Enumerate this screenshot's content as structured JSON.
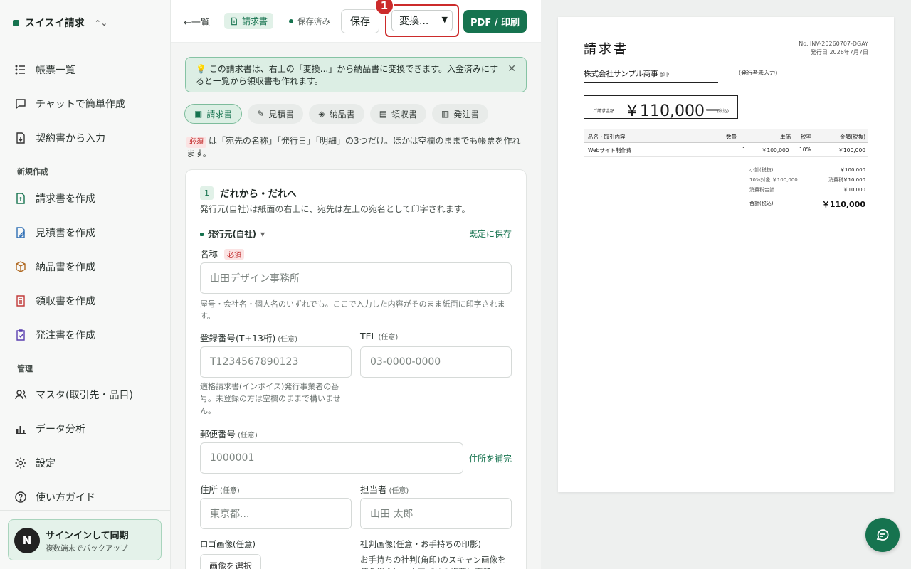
{
  "sidebar": {
    "brand": "スイスイ請求",
    "items": [
      {
        "label": "帳票一覧",
        "icon": "list-icon"
      },
      {
        "label": "チャットで簡単作成",
        "icon": "chat-icon"
      },
      {
        "label": "契約書から入力",
        "icon": "file-import-icon"
      }
    ],
    "section_new": "新規作成",
    "new_items": [
      {
        "label": "請求書を作成",
        "icon": "invoice-icon"
      },
      {
        "label": "見積書を作成",
        "icon": "quote-icon"
      },
      {
        "label": "納品書を作成",
        "icon": "box-icon"
      },
      {
        "label": "領収書を作成",
        "icon": "receipt-icon"
      },
      {
        "label": "発注書を作成",
        "icon": "order-icon"
      }
    ],
    "section_manage": "管理",
    "manage_items": [
      {
        "label": "マスタ(取引先・品目)",
        "icon": "users-icon"
      },
      {
        "label": "データ分析",
        "icon": "chart-icon"
      },
      {
        "label": "設定",
        "icon": "gear-icon"
      },
      {
        "label": "使い方ガイド",
        "icon": "help-icon"
      }
    ],
    "signin": {
      "avatar": "N",
      "title": "サインインして同期",
      "subtitle": "複数端末でバックアップ"
    }
  },
  "toolbar": {
    "back": "←一覧",
    "doc_type": "請求書",
    "status": "保存済み",
    "save": "保存",
    "convert": "変換...",
    "marker": "1",
    "pdf": "PDF / 印刷"
  },
  "editor": {
    "notice": "この請求書は、右上の「変換...」から納品書に変換できます。入金済みにすると一覧から領収書も作れます。",
    "tabs": [
      "請求書",
      "見積書",
      "納品書",
      "領収書",
      "発注書"
    ],
    "active_tab": 0,
    "required_tag": "必須",
    "required_note": "は「宛先の名称」「発行日」「明細」の3つだけ。ほかは空欄のままでも帳票を作れます。",
    "section": {
      "num": "1",
      "title": "だれから・だれへ",
      "desc": "発行元(自社)は紙面の右上に、宛先は左上の宛名として印字されます。",
      "issuer": "発行元(自社)",
      "default_save": "既定に保存"
    },
    "fields": {
      "name_label": "名称",
      "name_placeholder": "山田デザイン事務所",
      "name_hint": "屋号・会社名・個人名のいずれでも。ここで入力した内容がそのまま紙面に印字されます。",
      "reg_label": "登録番号(T+13桁)",
      "reg_placeholder": "T1234567890123",
      "reg_hint": "適格請求書(インボイス)発行事業者の番号。未登録の方は空欄のままで構いません。",
      "tel_label": "TEL",
      "tel_placeholder": "03-0000-0000",
      "postal_label": "郵便番号",
      "postal_value": "1000001",
      "address_fill": "住所を補完",
      "address_label": "住所",
      "address_placeholder": "東京都...",
      "contact_label": "担当者",
      "contact_placeholder": "山田 太郎",
      "logo_label": "ロゴ画像(任意)",
      "logo_button": "画像を選択",
      "seal_label": "社判画像(任意・お手持ちの印影)",
      "seal_hint": "お手持ちの社判(角印)のスキャン画像を使う場合に。本アプリの帳票に実印",
      "optional": "(任意)"
    }
  },
  "preview": {
    "title": "請求書",
    "number": "No. INV-20260707-DGAY",
    "date": "発行日 2026年7月7日",
    "client": "株式会社サンプル商事",
    "client_suffix": "御中",
    "issuer": "(発行者未入力)",
    "total_label": "ご請求金額",
    "total": "￥110,000ー",
    "total_tax": "(税込)",
    "table_headers": [
      "品名・取引内容",
      "数量",
      "単価",
      "税率",
      "金額(税抜)"
    ],
    "rows": [
      [
        "Webサイト制作費",
        "1",
        "￥100,000",
        "10%",
        "￥100,000"
      ]
    ],
    "subtotal_label": "小計(税抜)",
    "subtotal": "￥100,000",
    "tax_target": "10%対象 ￥100,000",
    "tax_label": "消費税",
    "tax": "￥10,000",
    "tax_total_label": "消費税合計",
    "tax_total": "￥10,000",
    "grand_label": "合計(税込)",
    "grand": "￥110,000"
  }
}
